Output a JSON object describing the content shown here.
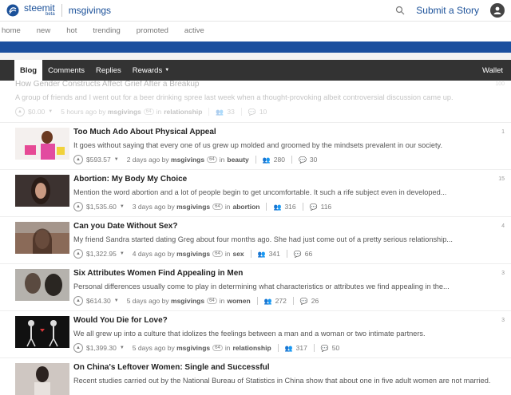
{
  "header": {
    "logo_text": "steemit",
    "logo_beta": "beta",
    "username": "msgivings",
    "submit_label": "Submit a Story"
  },
  "nav": [
    "home",
    "new",
    "hot",
    "trending",
    "promoted",
    "active"
  ],
  "tabs": {
    "blog": "Blog",
    "comments": "Comments",
    "replies": "Replies",
    "rewards": "Rewards",
    "wallet": "Wallet"
  },
  "posts": [
    {
      "title": "How Gender Constructs Affect Grief After a Breakup",
      "body": "A group of friends and I went out for a beer drinking spree last week when a thought-provoking albeit controversial discussion came up.",
      "payout": "$0.00",
      "time": "5 hours ago",
      "by": "by",
      "author": "msgivings",
      "rep": "64",
      "in": "in",
      "category": "relationship",
      "votes": "33",
      "comments": "10",
      "reblog": "100"
    },
    {
      "title": "Too Much Ado About Physical Appeal",
      "body": "It goes without saying that every one of us grew up molded and groomed by the mindsets prevalent in our society.",
      "payout": "$593.57",
      "time": "2 days ago",
      "by": "by",
      "author": "msgivings",
      "rep": "64",
      "in": "in",
      "category": "beauty",
      "votes": "280",
      "comments": "30",
      "reblog": "1"
    },
    {
      "title": "Abortion: My Body My Choice",
      "body": "Mention the word abortion and a lot of people begin to get uncomfortable. It such a rife subject even in developed...",
      "payout": "$1,535.60",
      "time": "3 days ago",
      "by": "by",
      "author": "msgivings",
      "rep": "64",
      "in": "in",
      "category": "abortion",
      "votes": "316",
      "comments": "116",
      "reblog": "15"
    },
    {
      "title": "Can you Date Without Sex?",
      "body": "My friend Sandra started dating Greg about four months ago. She had just come out of a pretty serious relationship...",
      "payout": "$1,322.95",
      "time": "4 days ago",
      "by": "by",
      "author": "msgivings",
      "rep": "64",
      "in": "in",
      "category": "sex",
      "votes": "341",
      "comments": "66",
      "reblog": "4"
    },
    {
      "title": "Six Attributes Women Find Appealing in Men",
      "body": "Personal differences usually come to play in determining what characteristics or attributes we find appealing in the...",
      "payout": "$614.30",
      "time": "5 days ago",
      "by": "by",
      "author": "msgivings",
      "rep": "64",
      "in": "in",
      "category": "women",
      "votes": "272",
      "comments": "26",
      "reblog": "3"
    },
    {
      "title": "Would You Die for Love?",
      "body": "We all grew up into a culture that idolizes the feelings between a man and a woman or two intimate partners.",
      "payout": "$1,399.30",
      "time": "5 days ago",
      "by": "by",
      "author": "msgivings",
      "rep": "64",
      "in": "in",
      "category": "relationship",
      "votes": "317",
      "comments": "50",
      "reblog": "3"
    },
    {
      "title": "On China's Leftover Women: Single and Successful",
      "body": "Recent studies carried out by the National Bureau of Statistics in China show that about one in five adult women are not married.",
      "reblog": ""
    }
  ],
  "colors": {
    "brand": "#1a5099",
    "banner": "#1b4f9e",
    "tabbar": "#333333"
  }
}
